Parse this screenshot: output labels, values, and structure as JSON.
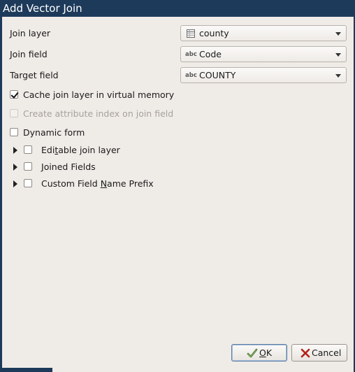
{
  "window": {
    "title": "Add Vector Join"
  },
  "fields": {
    "join_layer": {
      "label": "Join layer",
      "value": "county",
      "icon": "table-layer-icon"
    },
    "join_field": {
      "label": "Join field",
      "value": "Code",
      "type_badge": "abc"
    },
    "target_field": {
      "label": "Target field",
      "value": "COUNTY",
      "type_badge": "abc"
    }
  },
  "options": {
    "cache": {
      "label": "Cache join layer in virtual memory",
      "checked": true,
      "enabled": true
    },
    "attr_index": {
      "label": "Create attribute index on join field",
      "checked": false,
      "enabled": false
    },
    "dynamic_form": {
      "label": "Dynamic form",
      "checked": false,
      "enabled": true
    }
  },
  "groups": {
    "editable": {
      "label_pre": "Edi",
      "label_mnemonic": "t",
      "label_post": "able join layer",
      "checked": false,
      "expanded": false
    },
    "joined_fields": {
      "label_pre": "",
      "label_mnemonic": "J",
      "label_post": "oined Fields",
      "checked": false,
      "expanded": false
    },
    "prefix": {
      "label_pre": "Custom Field ",
      "label_mnemonic": "N",
      "label_post": "ame Prefix",
      "checked": false,
      "expanded": false
    }
  },
  "buttons": {
    "ok": {
      "label_mnemonic": "O",
      "label_post": "K",
      "icon": "checkmark-icon"
    },
    "cancel": {
      "label": "Cancel",
      "icon": "cancel-x-icon"
    }
  },
  "colors": {
    "titlebar": "#1d3a5a",
    "dialog_bg": "#efebe7",
    "disabled_text": "#a6a19c"
  }
}
